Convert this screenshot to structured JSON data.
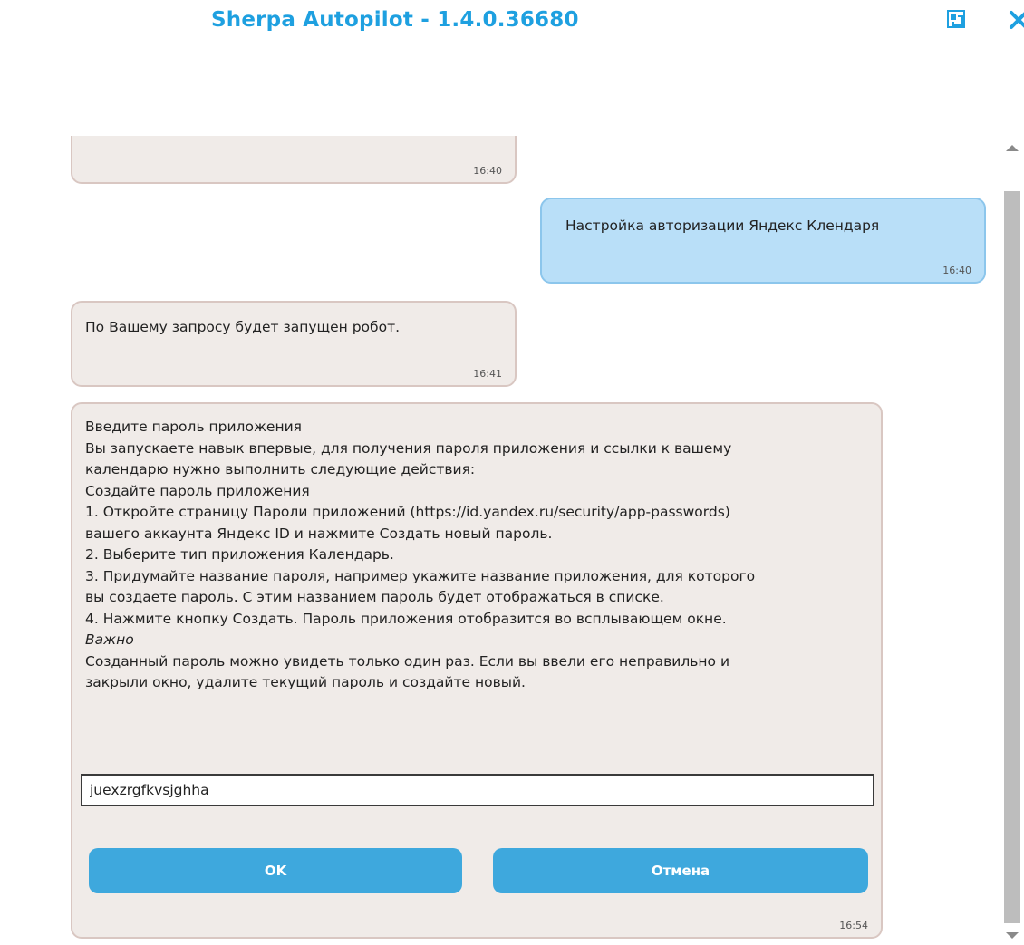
{
  "window": {
    "title": "Sherpa Autopilot - 1.4.0.36680",
    "restore_icon": "restore-window-icon",
    "close_icon": "close-icon",
    "accent": "#1ea0e0"
  },
  "messages": [
    {
      "from": "bot",
      "text": "",
      "time": "16:40"
    },
    {
      "from": "user",
      "text": "Настройка авторизации Яндекс Клендаря",
      "time": "16:40"
    },
    {
      "from": "bot",
      "text": "По Вашему запросу будет запущен робот.",
      "time": "16:41"
    }
  ],
  "prompt": {
    "lines": [
      "Введите пароль приложения",
      "Вы запускаете навык впервые, для получения пароля приложения и ссылки к вашему",
      "календарю нужно выполнить следующие действия:",
      "Создайте пароль приложения",
      "1. Откройте страницу Пароли приложений (https://id.yandex.ru/security/app-passwords)",
      "вашего аккаунта Яндекс ID и нажмите Создать новый пароль.",
      "2. Выберите тип приложения Календарь.",
      "3. Придумайте название пароля, например укажите название приложения, для которого",
      "вы создаете пароль. С этим названием пароль будет отображаться в списке.",
      "4. Нажмите кнопку Создать. Пароль приложения отобразится во всплывающем окне.",
      "Важно",
      "Созданный пароль можно увидеть только один раз. Если вы ввели его неправильно и",
      "закрыли окно, удалите текущий пароль и создайте новый."
    ],
    "input_value": "juexzrgfkvsjghha",
    "ok_label": "OK",
    "cancel_label": "Отмена",
    "time": "16:54"
  },
  "colors": {
    "bot_bubble": "#f0ebe8",
    "user_bubble": "#b9dff8",
    "button": "#3ea8dd"
  }
}
